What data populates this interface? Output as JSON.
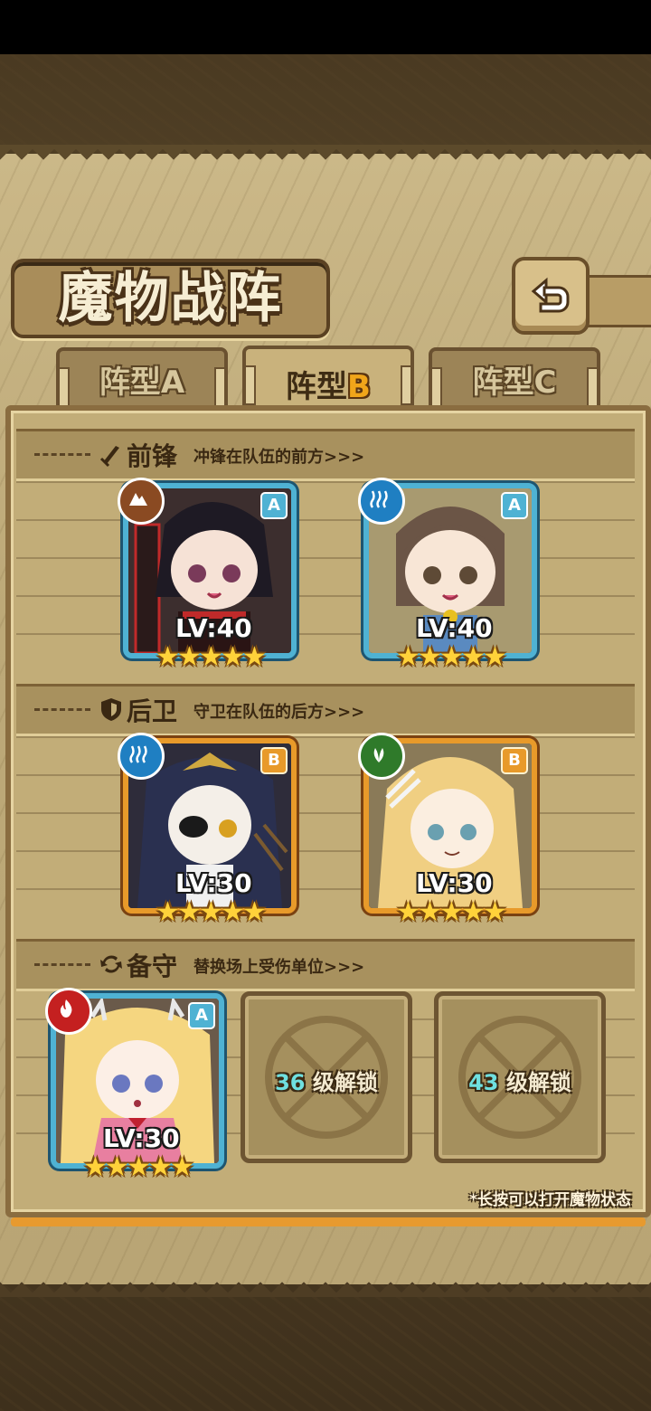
{
  "screen": {
    "title": "魔物战阵",
    "back_icon": "return-arrow-icon"
  },
  "tabs": [
    {
      "label": "阵型",
      "letter": "A",
      "active": false
    },
    {
      "label": "阵型",
      "letter": "B",
      "active": true
    },
    {
      "label": "阵型",
      "letter": "C",
      "active": false
    }
  ],
  "sections": {
    "front": {
      "title": "前锋",
      "desc": "冲锋在队伍的前方>>>",
      "icon": "sword-icon"
    },
    "rear": {
      "title": "后卫",
      "desc": "守卫在队伍的后方>>>",
      "icon": "shield-icon"
    },
    "reserve": {
      "title": "备守",
      "desc": "替换场上受伤单位>>>",
      "icon": "swap-icon"
    }
  },
  "units": {
    "front_1": {
      "level": "LV:40",
      "rank": "A",
      "stars": 5,
      "element": "earth-icon",
      "element_color": "#8a4a22"
    },
    "front_2": {
      "level": "LV:40",
      "rank": "A",
      "stars": 5,
      "element": "water-icon",
      "element_color": "#1f7fc2"
    },
    "rear_1": {
      "level": "LV:30",
      "rank": "B",
      "stars": 5,
      "element": "water-icon",
      "element_color": "#1f7fc2"
    },
    "rear_2": {
      "level": "LV:30",
      "rank": "B",
      "stars": 5,
      "element": "wind-icon",
      "element_color": "#2f7a2a"
    },
    "reserve_1": {
      "level": "LV:30",
      "rank": "A",
      "stars": 5,
      "element": "fire-icon",
      "element_color": "#c42020"
    }
  },
  "locked_slots": [
    {
      "level": "36",
      "text": "级解锁"
    },
    {
      "level": "43",
      "text": "级解锁"
    }
  ],
  "hint": "*长按可以打开魔物状态",
  "colors": {
    "rank_a": "#4fb2d3",
    "rank_b": "#e89a2a",
    "star": "#ffd23a"
  }
}
